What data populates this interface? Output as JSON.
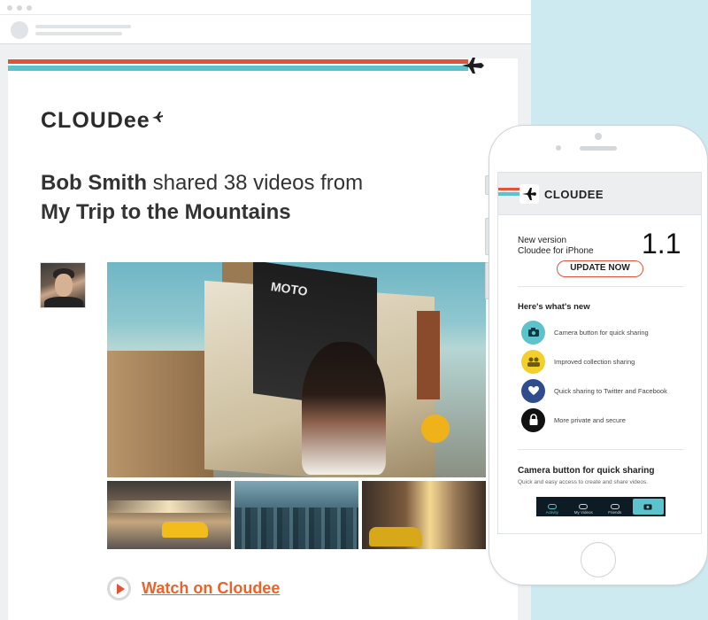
{
  "email": {
    "brand": "CLOUDee",
    "headline": {
      "sender": "Bob Smith",
      "action": " shared 38 videos from",
      "album": "My Trip to the Mountains"
    },
    "photo_billboard_text": "MOTO",
    "watch_label": "Watch on Cloudee"
  },
  "phone": {
    "app_title": "CLOUDEE",
    "version_line1": "New version",
    "version_line2": "Cloudee for iPhone",
    "version_number": "1.1",
    "update_label": "UPDATE NOW",
    "whats_new_title": "Here's what's new",
    "features": [
      {
        "label": "Camera button for quick sharing",
        "icon": "camera-icon",
        "color": "#5cc2cc"
      },
      {
        "label": "Improved collection sharing",
        "icon": "people-icon",
        "color": "#f3cf2b"
      },
      {
        "label": "Quick sharing to Twitter and Facebook",
        "icon": "heart-icon",
        "color": "#2f4c8c"
      },
      {
        "label": "More private and secure",
        "icon": "lock-icon",
        "color": "#111111"
      }
    ],
    "camera_section_title": "Camera button for quick sharing",
    "camera_section_sub": "Quick and easy access to create and share videos.",
    "tabs": [
      {
        "label": "Activity",
        "active": true
      },
      {
        "label": "My Videos",
        "active": false
      },
      {
        "label": "Friends",
        "active": false
      }
    ]
  },
  "colors": {
    "brand_red": "#e2543a",
    "brand_teal": "#5cc2cc",
    "link_orange": "#ef6227"
  }
}
